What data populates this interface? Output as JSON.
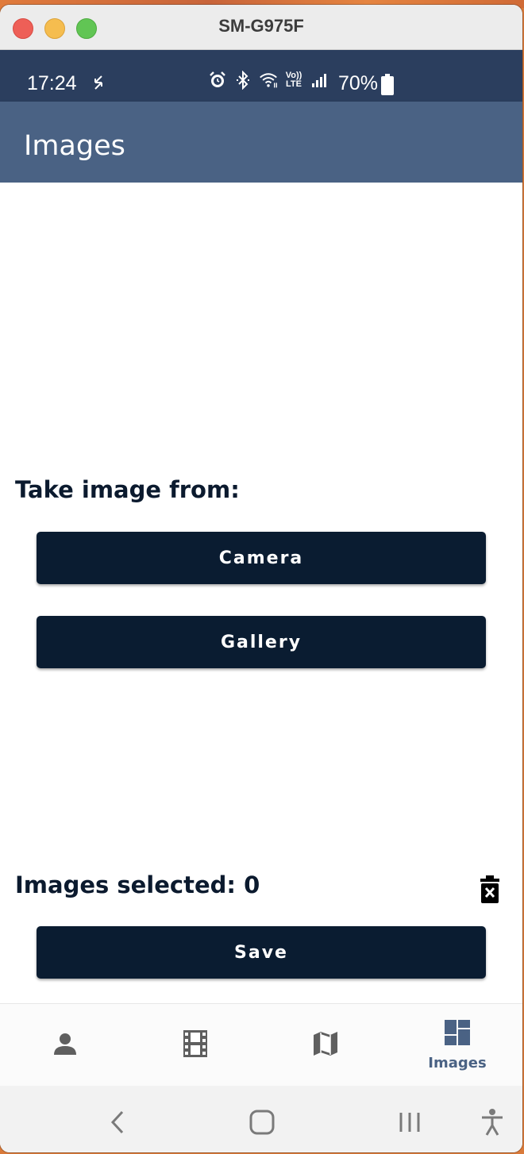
{
  "window": {
    "title": "SM-G975F"
  },
  "status_bar": {
    "time": "17:24",
    "lte_label": "Vo)) LTE",
    "battery_percent": "70%"
  },
  "app_bar": {
    "title": "Images"
  },
  "image_source": {
    "heading": "Take image from:",
    "camera_label": "Camera",
    "gallery_label": "Gallery"
  },
  "selection": {
    "label": "Images selected: 0",
    "count": 0
  },
  "actions": {
    "save_label": "Save"
  },
  "bottom_nav": {
    "items": [
      {
        "icon": "person-icon",
        "label": ""
      },
      {
        "icon": "film-icon",
        "label": ""
      },
      {
        "icon": "map-icon",
        "label": ""
      },
      {
        "icon": "dashboard-icon",
        "label": "Images",
        "active": true
      }
    ]
  },
  "colors": {
    "status_bar": "#2b3e5e",
    "app_bar": "#4a6284",
    "button": "#0a1c31",
    "active_nav": "#4a6284"
  }
}
